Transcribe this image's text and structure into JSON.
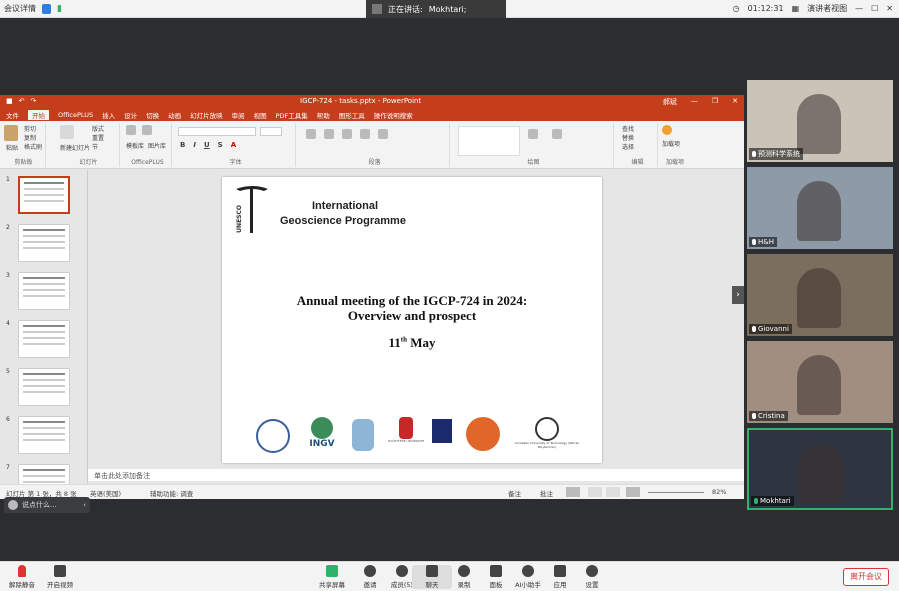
{
  "topbar": {
    "app_name": "会议详情",
    "speaking_label": "正在讲话:",
    "speaker": "Mokhtari;",
    "timer": "01:12:31",
    "view_label": "演讲者视图"
  },
  "ppt": {
    "title": "IGCP-724 - tasks.pptx - PowerPoint",
    "user": "郝斌",
    "tabs": [
      "文件",
      "开始",
      "OfficePLUS",
      "插入",
      "设计",
      "切换",
      "动画",
      "幻灯片放映",
      "审阅",
      "视图",
      "PDF工具集",
      "帮助",
      "图形工具",
      "操作说明搜索"
    ],
    "active_tab": "开始",
    "ribbon_groups": [
      "剪贴板",
      "幻灯片",
      "OfficePLUS",
      "字体",
      "段落",
      "绘图",
      "编辑",
      "加载项"
    ],
    "ribbon_buttons": {
      "paste": "粘贴",
      "cut": "剪切",
      "copy": "复制",
      "format_painter": "格式刷",
      "new_slide": "新建幻灯片",
      "layout": "版式",
      "reset": "重置",
      "section": "节",
      "template": "模板库",
      "pic": "图片库",
      "find": "查找",
      "replace": "替换",
      "select": "选择",
      "addin": "加载项"
    },
    "thumb_numbers": [
      "1",
      "2",
      "3",
      "4",
      "5",
      "6",
      "7"
    ],
    "notes_placeholder": "单击此处添加备注",
    "status": {
      "slide_info": "幻灯片 第 1 张，共 8 张",
      "language": "英语(美国)",
      "accessibility": "辅助功能: 调查",
      "notes": "备注",
      "comments": "批注",
      "zoom": "82%"
    }
  },
  "slide": {
    "logo_text": "UNESCO",
    "program_line1": "International",
    "program_line2": "Geoscience Programme",
    "heading_line1": "Annual meeting of the IGCP-724 in 2024:",
    "heading_line2": "Overview and prospect",
    "date_day": "11",
    "date_suffix": "th",
    "date_month": "May",
    "logos": [
      "INGV",
      "HACETTEPE ÜNİVERSİTESİ",
      "Amirkabir University of Technology (Tehran Polytechnic)"
    ]
  },
  "input_chip": "说点什么...",
  "participants": [
    {
      "name": "预测科学系统"
    },
    {
      "name": "H&H"
    },
    {
      "name": "Giovanni"
    },
    {
      "name": "Cristina"
    },
    {
      "name": "Mokhtari"
    }
  ],
  "bottombar": {
    "unmute": "解除静音",
    "stop_video": "开启视频",
    "share": "共享屏幕",
    "invite": "邀请",
    "members": "成员(5)",
    "chat": "聊天",
    "record": "录制",
    "apps": "应用",
    "ai": "AI小助手",
    "app2": "应用",
    "settings": "设置",
    "leave": "离开会议",
    "zoom_btn": "面板"
  },
  "colors": {
    "ppt_accent": "#c43e1c",
    "active_speaker": "#2db36b",
    "leave": "#dd3333"
  }
}
